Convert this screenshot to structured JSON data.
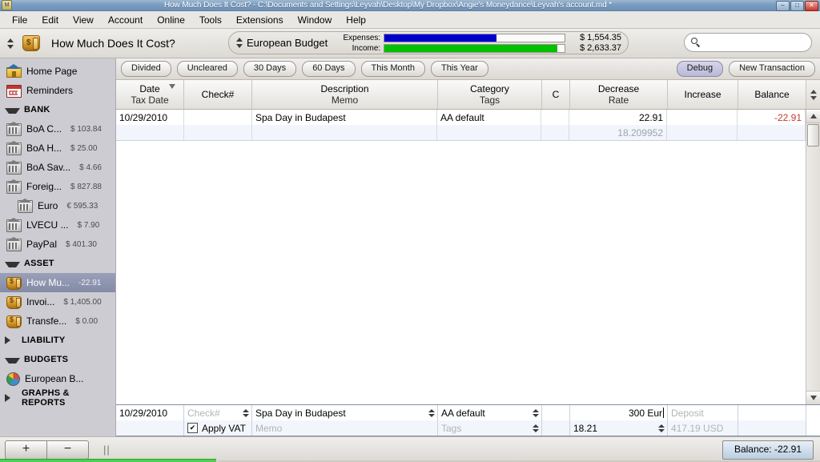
{
  "window": {
    "title": "How Much Does It Cost? - C:\\Documents and Settings\\Leyvah\\Desktop\\My Dropbox\\Angie's Moneydance\\Leyvah's account.md *",
    "app_icon": "moneydance-icon",
    "buttons": {
      "minimize": "–",
      "maximize": "□",
      "close": "✕"
    }
  },
  "menubar": {
    "items": [
      {
        "label": "File",
        "mnemonic": "F"
      },
      {
        "label": "Edit",
        "mnemonic": "E"
      },
      {
        "label": "View",
        "mnemonic": "V"
      },
      {
        "label": "Account",
        "mnemonic": "A"
      },
      {
        "label": "Online",
        "mnemonic": "O"
      },
      {
        "label": "Tools",
        "mnemonic": "T"
      },
      {
        "label": "Extensions",
        "mnemonic": "x"
      },
      {
        "label": "Window",
        "mnemonic": "W"
      },
      {
        "label": "Help",
        "mnemonic": "H"
      }
    ]
  },
  "toolbar": {
    "account_title": "How Much Does It Cost?",
    "account_icon": "money-bag-icon",
    "budget_name": "European Budget",
    "expenses_label": "Expenses:",
    "expenses_amount": "$ 1,554.35",
    "expenses_percent": 62,
    "expenses_color": "#0000cd",
    "income_label": "Income:",
    "income_amount": "$ 2,633.37",
    "income_percent": 96,
    "income_color": "#00c000",
    "search_placeholder": "",
    "search_value": ""
  },
  "filters": {
    "left": [
      "Divided",
      "Uncleared",
      "30 Days",
      "60 Days",
      "This Month",
      "This Year"
    ],
    "right": [
      {
        "label": "Debug",
        "highlighted": true
      },
      {
        "label": "New Transaction",
        "highlighted": false
      }
    ]
  },
  "sidebar": {
    "top_items": [
      {
        "label": "Home Page",
        "icon": "home-icon"
      },
      {
        "label": "Reminders",
        "icon": "calendar-icon"
      }
    ],
    "groups": [
      {
        "label": "BANK",
        "expanded": true,
        "icon": "triangle-down-icon",
        "items": [
          {
            "label": "BoA C...",
            "amount": "$ 103.84",
            "icon": "bank-icon",
            "indent": false,
            "selected": false
          },
          {
            "label": "BoA H...",
            "amount": "$ 25.00",
            "icon": "bank-icon",
            "indent": false,
            "selected": false
          },
          {
            "label": "BoA Sav...",
            "amount": "$ 4.66",
            "icon": "bank-icon",
            "indent": false,
            "selected": false
          },
          {
            "label": "Foreig...",
            "amount": "$ 827.88",
            "icon": "bank-icon",
            "indent": false,
            "selected": false
          },
          {
            "label": "Euro",
            "amount": "€ 595.33",
            "icon": "bank-icon",
            "indent": true,
            "selected": false
          },
          {
            "label": "LVECU ...",
            "amount": "$ 7.90",
            "icon": "bank-icon",
            "indent": false,
            "selected": false
          },
          {
            "label": "PayPal",
            "amount": "$ 401.30",
            "icon": "bank-icon",
            "indent": false,
            "selected": false
          }
        ]
      },
      {
        "label": "ASSET",
        "expanded": true,
        "icon": "triangle-down-icon",
        "items": [
          {
            "label": "How Mu...",
            "amount": "-22.91",
            "icon": "money-bag-icon",
            "indent": false,
            "selected": true
          },
          {
            "label": "Invoi...",
            "amount": "$ 1,405.00",
            "icon": "money-bag-icon",
            "indent": false,
            "selected": false
          },
          {
            "label": "Transfe...",
            "amount": "$ 0.00",
            "icon": "money-bag-icon",
            "indent": false,
            "selected": false
          }
        ]
      },
      {
        "label": "LIABILITY",
        "expanded": false,
        "icon": "triangle-right-icon",
        "items": []
      },
      {
        "label": "BUDGETS",
        "expanded": true,
        "icon": "triangle-down-icon",
        "items": [
          {
            "label": "European B...",
            "amount": "",
            "icon": "pie-chart-icon",
            "indent": false,
            "selected": false
          }
        ]
      },
      {
        "label": "GRAPHS & REPORTS",
        "expanded": false,
        "icon": "triangle-right-icon",
        "items": []
      }
    ]
  },
  "register": {
    "columns": [
      {
        "line1": "Date",
        "line2": "Tax Date",
        "sorted": true
      },
      {
        "line1": "Check#",
        "line2": "",
        "sorted": false
      },
      {
        "line1": "Description",
        "line2": "Memo",
        "sorted": false
      },
      {
        "line1": "Category",
        "line2": "Tags",
        "sorted": false
      },
      {
        "line1": "C",
        "line2": "",
        "sorted": false
      },
      {
        "line1": "Decrease",
        "line2": "Rate",
        "sorted": false
      },
      {
        "line1": "Increase",
        "line2": "",
        "sorted": false
      },
      {
        "line1": "Balance",
        "line2": "",
        "sorted": false
      }
    ],
    "rows": [
      {
        "date": "10/29/2010",
        "tax_date": "",
        "check": "",
        "check_line2": "",
        "description": "Spa Day in Budapest",
        "memo": "",
        "category": "AA default",
        "tags": "",
        "cleared": "",
        "decrease": "22.91",
        "rate": "18.209952",
        "increase": "",
        "increase_line2": "",
        "balance": "-22.91",
        "balance_negative": true
      }
    ]
  },
  "edit_row": {
    "date": "10/29/2010",
    "check_placeholder": "Check#",
    "check_value": "",
    "apply_vat_label": "Apply VAT",
    "apply_vat_checked": true,
    "description_value": "Spa Day in Budapest",
    "memo_placeholder": "Memo",
    "memo_value": "",
    "category_value": "AA default",
    "tags_placeholder": "Tags",
    "tags_value": "",
    "cleared_value": "",
    "amount_value": "300 Eur",
    "rate_value": "18.21",
    "deposit_placeholder": "Deposit",
    "converted_value": "417.19 USD"
  },
  "footer": {
    "add_label": "+",
    "remove_label": "−",
    "grip": "||",
    "balance_label": "Balance: -22.91"
  }
}
